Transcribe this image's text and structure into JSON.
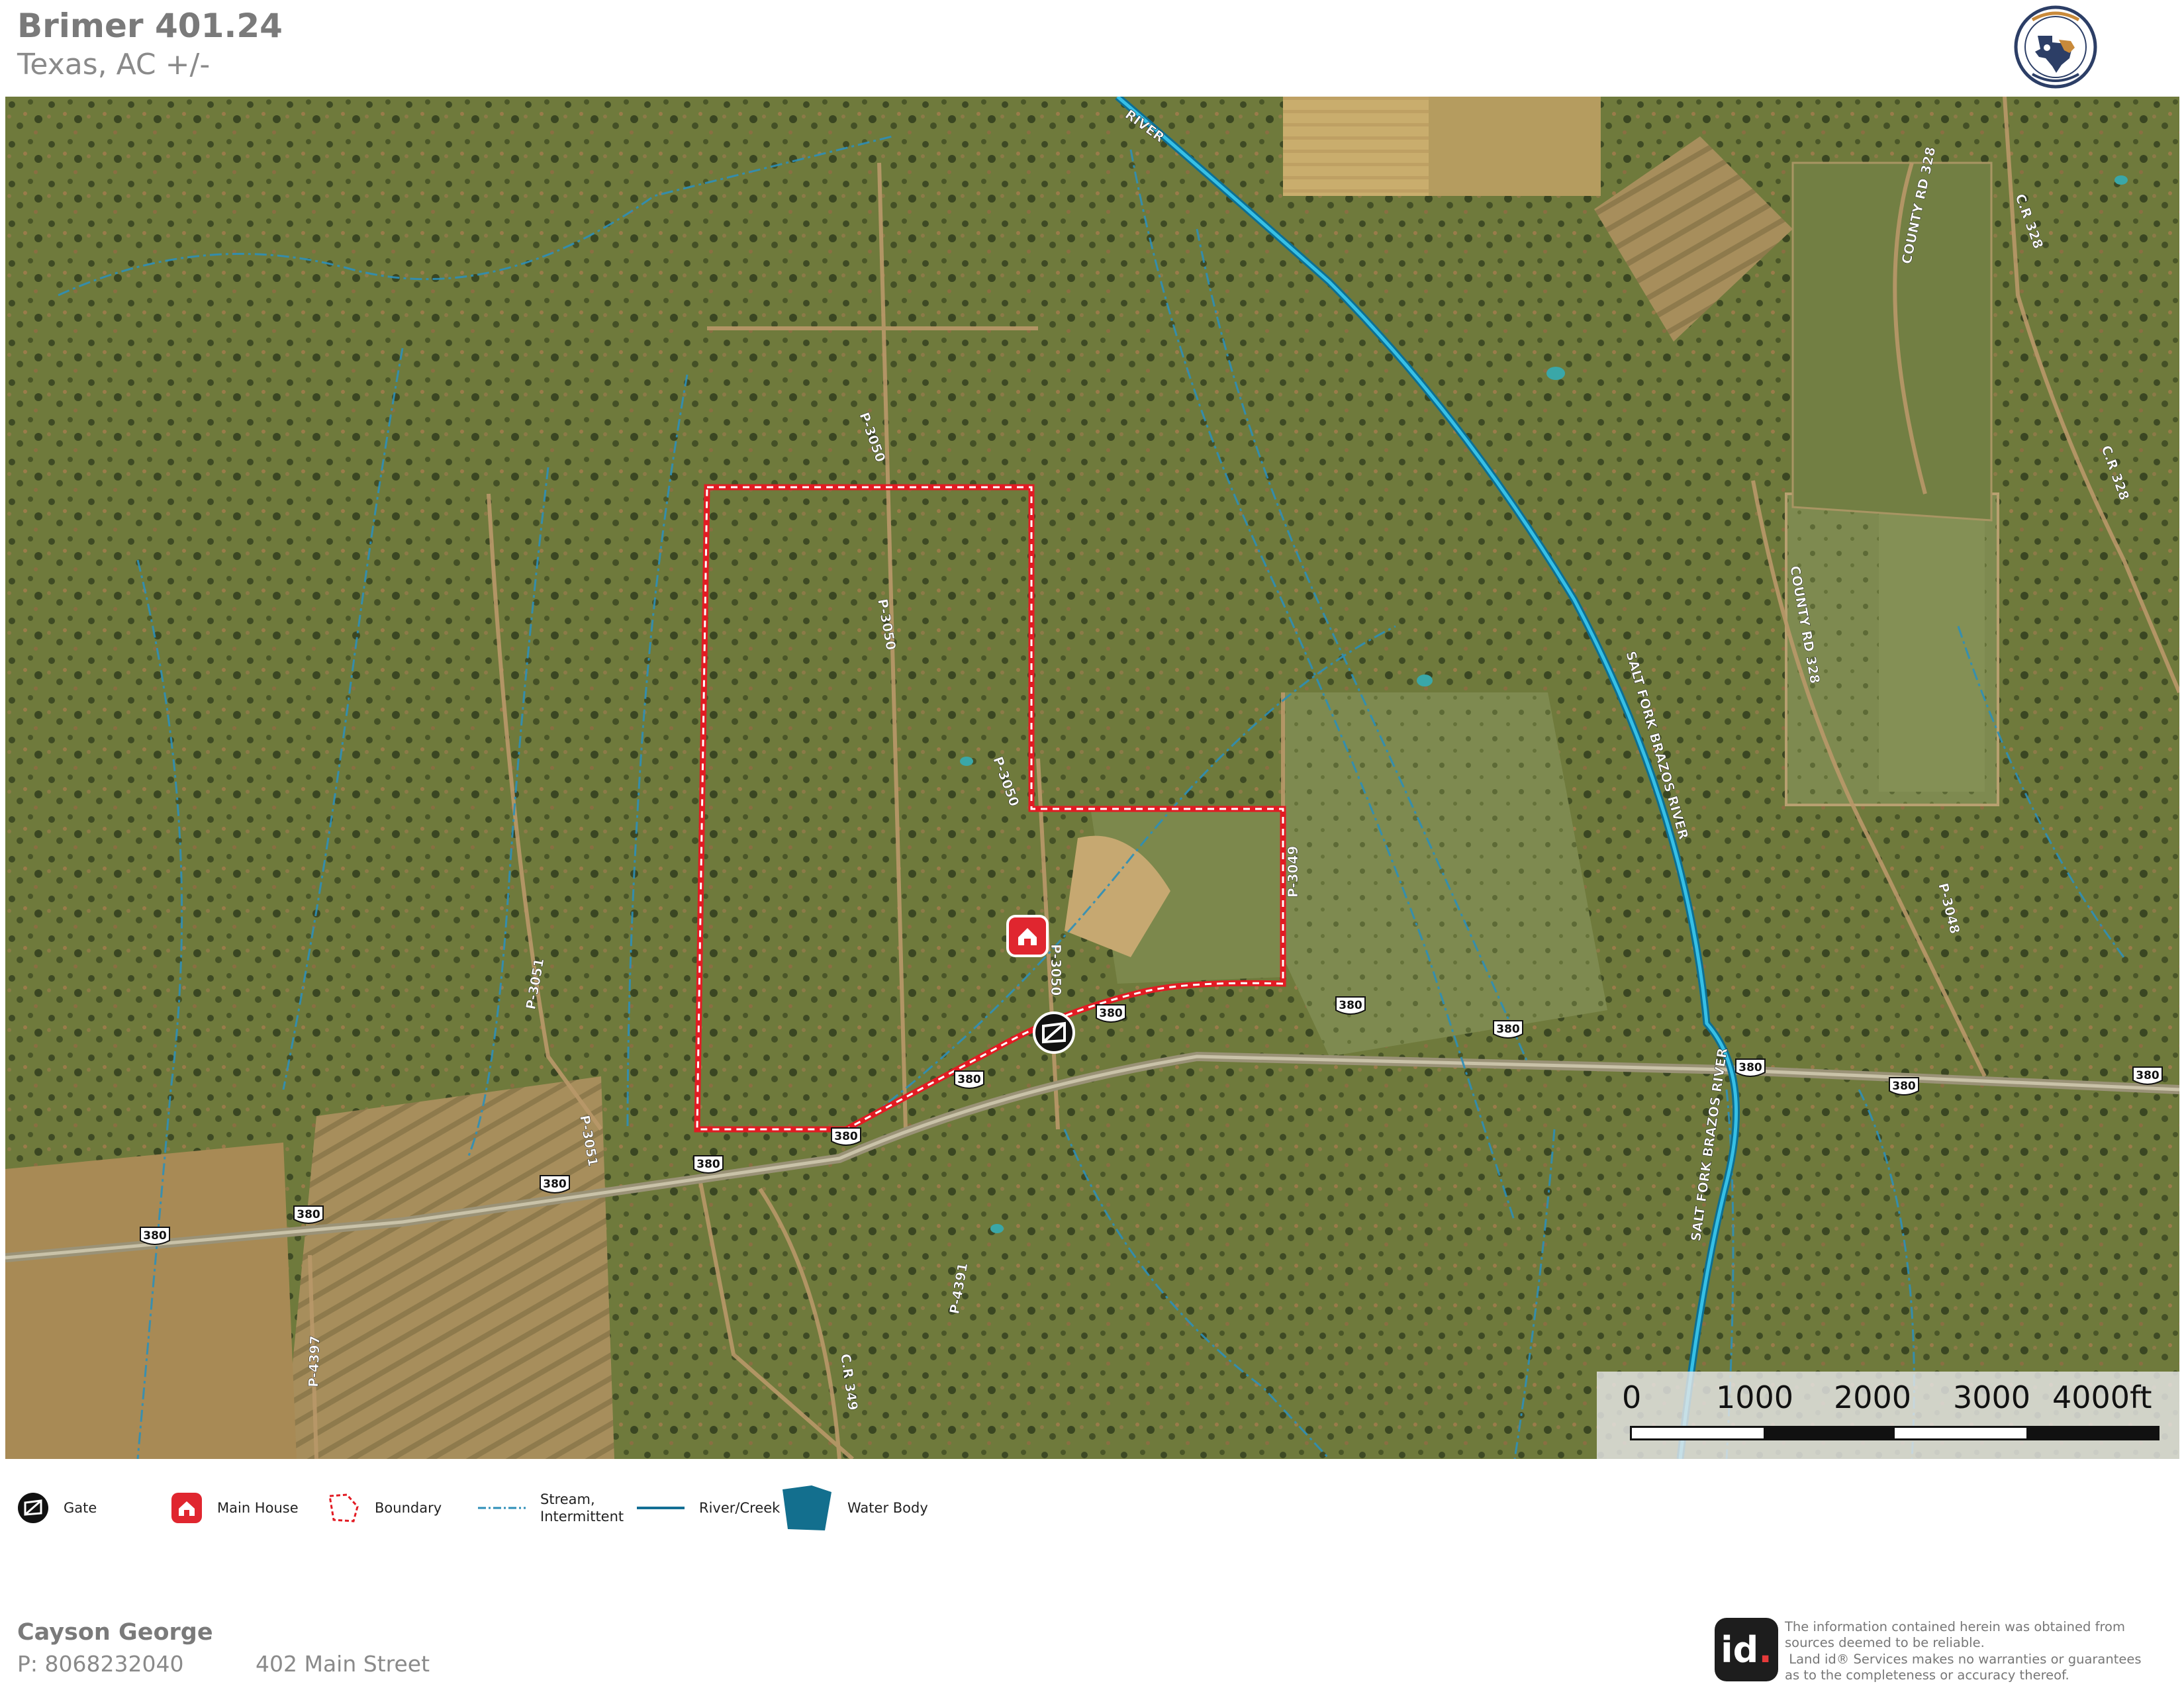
{
  "header": {
    "title": "Brimer 401.24",
    "subtitle": "Texas,  AC +/-"
  },
  "logo": {
    "ring_text": "WESTERN HERITAGE",
    "bottom_text": "REALTY & INVESTMENTS",
    "colors": {
      "ring": "#2c3e66",
      "texas": "#2c3e66",
      "accent": "#c98a3a"
    }
  },
  "map": {
    "river_labels": {
      "river_top": "RIVER",
      "salt_fork_1": "SALT FORK BRAZOS RIVER",
      "salt_fork_2": "SALT FORK BRAZOS RIVER"
    },
    "road_labels": {
      "p3050_a": "P-3050",
      "p3050_b": "P-3050",
      "p3050_c": "P-3050",
      "p3050_d": "P-3050",
      "p3049": "P-3049",
      "p3051_a": "P-3051",
      "p3051_b": "P-3051",
      "p4391": "P-4391",
      "p4397": "P-4397",
      "p3048": "P-3048",
      "cr349": "C.R 349",
      "cr328_a": "C.R 328",
      "cr328_b": "C.R 328",
      "county328_a": "COUNTY RD 328",
      "county328_b": "COUNTY RD 328"
    },
    "hwy_shields": [
      "380",
      "380",
      "380",
      "380",
      "380",
      "380",
      "380",
      "380",
      "380",
      "380",
      "380",
      "380"
    ],
    "colors": {
      "boundary": "#e21b23",
      "river": "#1a9bc6",
      "stream": "#2d8fb8",
      "house": "#e0262f",
      "gate": "#111111"
    }
  },
  "scalebar": {
    "labels": [
      "0",
      "1000",
      "2000",
      "3000",
      "4000ft"
    ]
  },
  "legend": {
    "items": [
      {
        "label": "Gate",
        "icon": "gate-icon"
      },
      {
        "label": "Main House",
        "icon": "main-house-icon"
      },
      {
        "label": "Boundary",
        "icon": "boundary-icon"
      },
      {
        "label": "Stream,",
        "label2": "Intermittent",
        "icon": "stream-icon"
      },
      {
        "label": "River/Creek",
        "icon": "river-icon"
      },
      {
        "label": "Water Body",
        "icon": "water-body-icon"
      }
    ]
  },
  "footer": {
    "name": "Cayson George",
    "phone": "P: 8068232040",
    "address": "402 Main Street",
    "id_logo": "id",
    "disclaimer_1": "The information contained herein was obtained from",
    "disclaimer_2": "sources deemed to be reliable.",
    "disclaimer_3": "Land id® Services makes no warranties or guarantees",
    "disclaimer_4": "as to the completeness or accuracy thereof."
  }
}
